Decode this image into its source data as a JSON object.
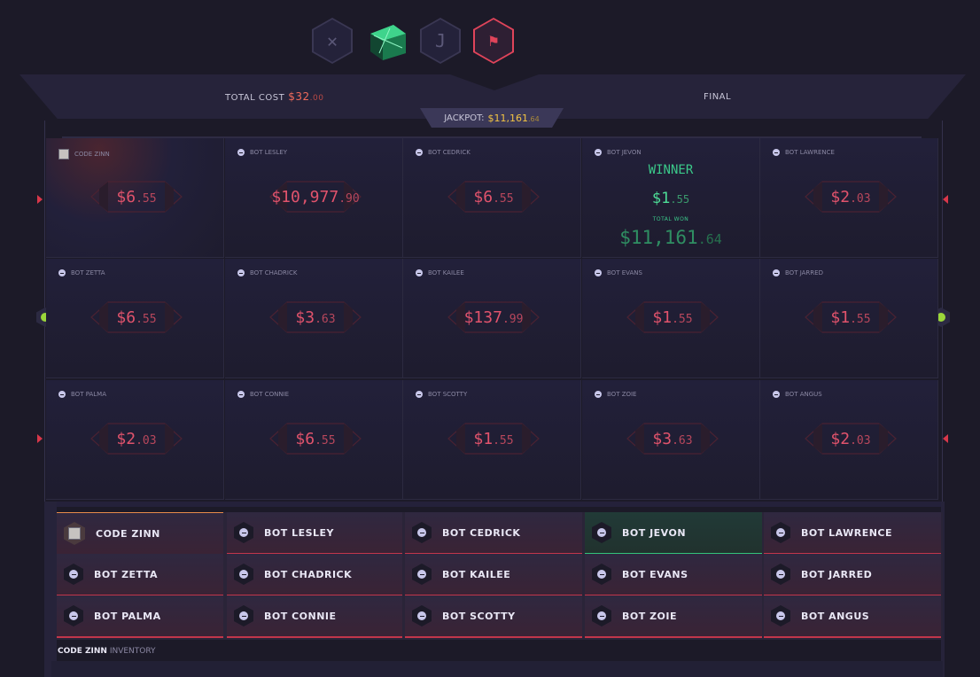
{
  "round_icons": [
    {
      "name": "x-icon",
      "glyph": "✕"
    },
    {
      "name": "case-icon",
      "glyph": ""
    },
    {
      "name": "j-icon",
      "glyph": "J"
    },
    {
      "name": "checkered-flag-icon",
      "glyph": "⚑"
    }
  ],
  "header": {
    "total_cost_label": "TOTAL COST",
    "total_cost_dollars": "$32",
    "total_cost_cents": ".00",
    "status": "FINAL",
    "jackpot_label": "JACKPOT:",
    "jackpot_dollars": "$11,161",
    "jackpot_cents": ".64"
  },
  "grid": [
    [
      {
        "name": "CODE ZINN",
        "dollars": "$6",
        "cents": ".55",
        "avatar": "cube"
      },
      {
        "name": "BOT LESLEY",
        "dollars": "$10,977",
        "cents": ".90",
        "avatar": "bot"
      },
      {
        "name": "BOT CEDRICK",
        "dollars": "$6",
        "cents": ".55",
        "avatar": "bot"
      },
      {
        "name": "BOT JEVON",
        "dollars": "$1",
        "cents": ".55",
        "avatar": "bot",
        "winner": true
      },
      {
        "name": "BOT LAWRENCE",
        "dollars": "$2",
        "cents": ".03",
        "avatar": "bot"
      }
    ],
    [
      {
        "name": "BOT ZETTA",
        "dollars": "$6",
        "cents": ".55",
        "avatar": "bot"
      },
      {
        "name": "BOT CHADRICK",
        "dollars": "$3",
        "cents": ".63",
        "avatar": "bot"
      },
      {
        "name": "BOT KAILEE",
        "dollars": "$137",
        "cents": ".99",
        "avatar": "bot"
      },
      {
        "name": "BOT EVANS",
        "dollars": "$1",
        "cents": ".55",
        "avatar": "bot"
      },
      {
        "name": "BOT JARRED",
        "dollars": "$1",
        "cents": ".55",
        "avatar": "bot"
      }
    ],
    [
      {
        "name": "BOT PALMA",
        "dollars": "$2",
        "cents": ".03",
        "avatar": "bot"
      },
      {
        "name": "BOT CONNIE",
        "dollars": "$6",
        "cents": ".55",
        "avatar": "bot"
      },
      {
        "name": "BOT SCOTTY",
        "dollars": "$1",
        "cents": ".55",
        "avatar": "bot"
      },
      {
        "name": "BOT ZOIE",
        "dollars": "$3",
        "cents": ".63",
        "avatar": "bot"
      },
      {
        "name": "BOT ANGUS",
        "dollars": "$2",
        "cents": ".03",
        "avatar": "bot"
      }
    ]
  ],
  "winner_panel": {
    "winner_label": "WINNER",
    "total_won_label": "TOTAL WON",
    "total_won_dollars": "$11,161",
    "total_won_cents": ".64"
  },
  "players": [
    [
      "CODE ZINN",
      "BOT LESLEY",
      "BOT CEDRICK",
      "BOT JEVON",
      "BOT LAWRENCE"
    ],
    [
      "BOT ZETTA",
      "BOT CHADRICK",
      "BOT KAILEE",
      "BOT EVANS",
      "BOT JARRED"
    ],
    [
      "BOT PALMA",
      "BOT CONNIE",
      "BOT SCOTTY",
      "BOT ZOIE",
      "BOT ANGUS"
    ]
  ],
  "inventory": {
    "owner": "CODE ZINN",
    "label": "INVENTORY"
  },
  "colors": {
    "accent_red": "#e1536c",
    "winner_green": "#3bc98a",
    "jackpot_gold": "#f3c443"
  }
}
